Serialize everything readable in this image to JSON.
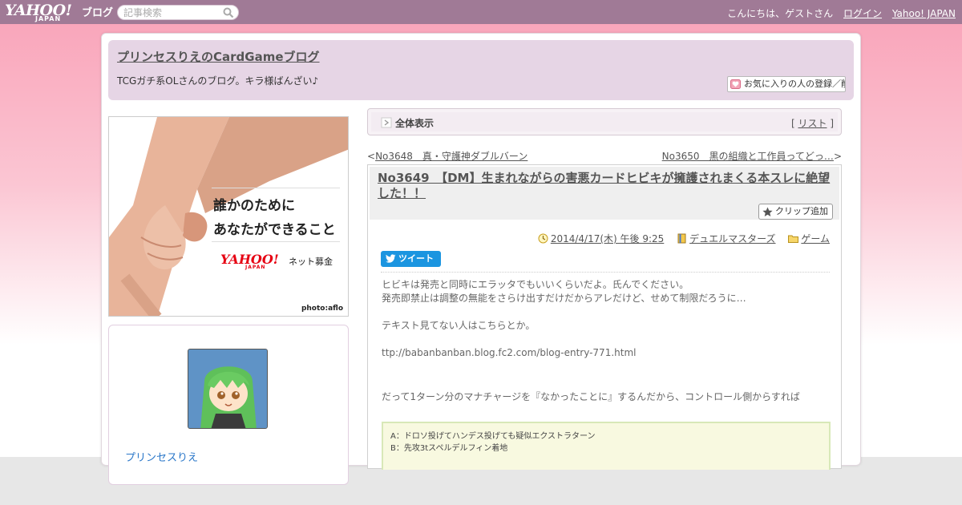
{
  "topbar": {
    "logo_yahoo": "YAHOO!",
    "logo_japan": "JAPAN",
    "logo_blog": "ブログ",
    "search_placeholder": "記事検索",
    "greeting": "こんにちは、ゲストさん",
    "login": "ログイン",
    "yahoo_japan": "Yahoo! JAPAN"
  },
  "header": {
    "blog_title": "プリンセスりえのCardGameブログ",
    "description": "TCGガチ系OLさんのブログ。キラ様ばんざい♪",
    "fav_button": "お気に入りの人の登録／削除"
  },
  "ad": {
    "line1": "誰かのために",
    "line2": "あなたができること",
    "yahoo": "YAHOO!",
    "japan": "JAPAN",
    "bokin": "ネット募金",
    "photo_credit": "photo:aflo"
  },
  "profile": {
    "name": "プリンセスりえ"
  },
  "allview": {
    "label": "全体表示",
    "list_open": "[ ",
    "list_link": "リスト",
    "list_close": " ]"
  },
  "nav": {
    "prev_prefix": "<",
    "prev": "No3648　真・守護神ダブルバーン",
    "next": "No3650　黒の組織と工作員ってどっ…",
    "next_suffix": ">"
  },
  "article": {
    "title": "No3649　【DM】生まれながらの害悪カードヒビキが擁護されまくる本スレに絶望した！！",
    "clip_button": "クリップ追加",
    "date": "2014/4/17(木) 午後 9:25",
    "category1": "デュエルマスターズ",
    "category2": "ゲーム",
    "tweet": "ツイート",
    "paragraphs": [
      "ヒビキは発売と同時にエラッタでもいいくらいだよ。氏んでください。",
      "発売即禁止は調整の無能をさらけ出すだけだからアレだけど、せめて制限だろうに…",
      "テキスト見てない人はこちらとか。",
      "ttp://babanbanban.blog.fc2.com/blog-entry-771.html",
      "だって1ターン分のマナチャージを『なかったことに』するんだから、コントロール側からすれば"
    ],
    "quote_lines": [
      "A：ドロソ投げてハンデス投げても疑似エクストラターン",
      "B：先攻3tスペルデルフィン着地"
    ]
  },
  "colors": {
    "topbar": "#a07a96",
    "header_bg": "#e6d5e5",
    "link_blue": "#2a77c9",
    "tweet_blue": "#1b95e0"
  }
}
